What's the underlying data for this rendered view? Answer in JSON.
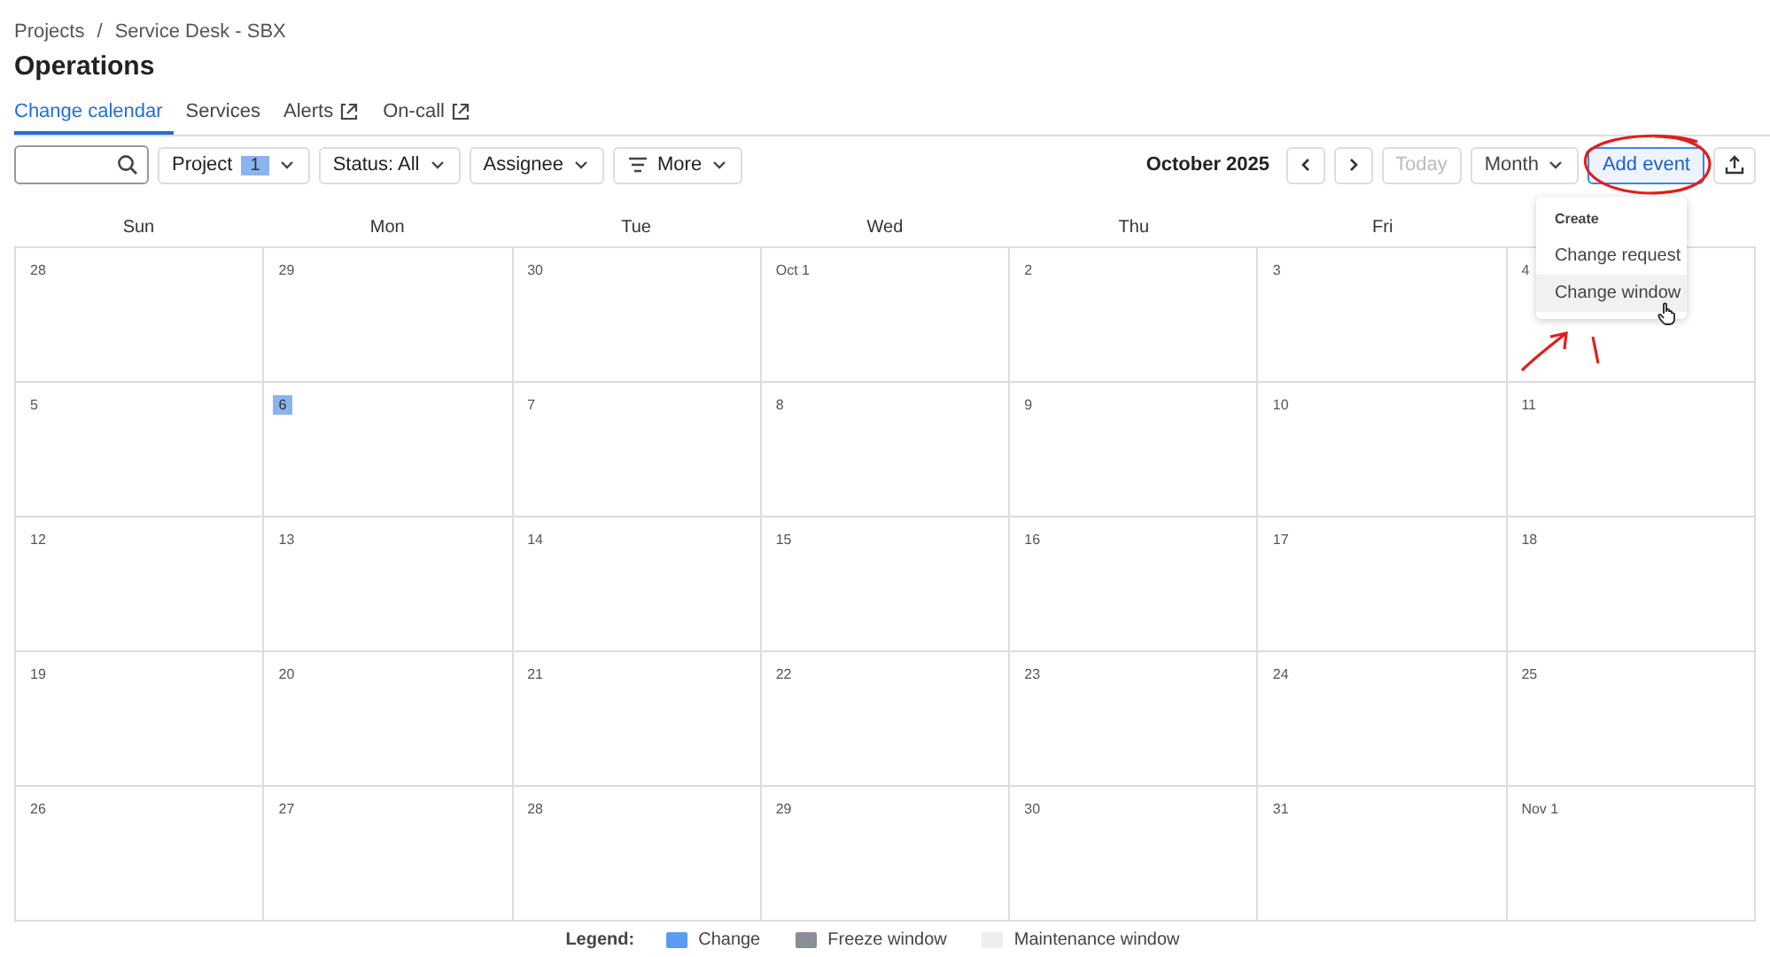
{
  "breadcrumb": [
    "Projects",
    "Service Desk - SBX"
  ],
  "breadcrumb_separator": "/",
  "title": "Operations",
  "tabs": [
    {
      "label": "Change calendar",
      "selected": true,
      "external": false
    },
    {
      "label": "Services",
      "selected": false,
      "external": false
    },
    {
      "label": "Alerts",
      "selected": false,
      "external": true
    },
    {
      "label": "On-call",
      "selected": false,
      "external": true
    }
  ],
  "filters": [
    {
      "label": "Project",
      "count": "1",
      "kind": "count"
    },
    {
      "label": "Status: All",
      "kind": "plain"
    },
    {
      "label": "Assignee",
      "kind": "plain"
    },
    {
      "label": "More",
      "kind": "more"
    }
  ],
  "period": "October 2025",
  "today_button": {
    "label": "Today",
    "disabled": true
  },
  "view": "Month",
  "add_button": "Add event",
  "menu": {
    "heading": "Create",
    "items": [
      {
        "label": "Change request",
        "hovered": false
      },
      {
        "label": "Change window",
        "hovered": true
      }
    ]
  },
  "weekdays": [
    "Sun",
    "Mon",
    "Tue",
    "Wed",
    "Thu",
    "Fri"
  ],
  "weeks": [
    [
      {
        "label": "28",
        "today": false
      },
      {
        "label": "29",
        "today": false
      },
      {
        "label": "30",
        "today": false
      },
      {
        "label": "Oct 1",
        "today": false
      },
      {
        "label": "2",
        "today": false
      },
      {
        "label": "3",
        "today": false
      },
      {
        "label": "4",
        "today": false
      }
    ],
    [
      {
        "label": "5",
        "today": false
      },
      {
        "label": "6",
        "today": true
      },
      {
        "label": "7",
        "today": false
      },
      {
        "label": "8",
        "today": false
      },
      {
        "label": "9",
        "today": false
      },
      {
        "label": "10",
        "today": false
      },
      {
        "label": "11",
        "today": false
      }
    ],
    [
      {
        "label": "12",
        "today": false
      },
      {
        "label": "13",
        "today": false
      },
      {
        "label": "14",
        "today": false
      },
      {
        "label": "15",
        "today": false
      },
      {
        "label": "16",
        "today": false
      },
      {
        "label": "17",
        "today": false
      },
      {
        "label": "18",
        "today": false
      }
    ],
    [
      {
        "label": "19",
        "today": false
      },
      {
        "label": "20",
        "today": false
      },
      {
        "label": "21",
        "today": false
      },
      {
        "label": "22",
        "today": false
      },
      {
        "label": "23",
        "today": false
      },
      {
        "label": "24",
        "today": false
      },
      {
        "label": "25",
        "today": false
      }
    ],
    [
      {
        "label": "26",
        "today": false
      },
      {
        "label": "27",
        "today": false
      },
      {
        "label": "28",
        "today": false
      },
      {
        "label": "29",
        "today": false
      },
      {
        "label": "30",
        "today": false
      },
      {
        "label": "31",
        "today": false
      },
      {
        "label": "Nov 1",
        "today": false
      }
    ]
  ],
  "legend": {
    "label": "Legend:",
    "items": [
      {
        "label": "Change",
        "color": "#5b9cf0"
      },
      {
        "label": "Freeze window",
        "color": "#8a8d93"
      },
      {
        "label": "Maintenance window",
        "color": "#eceef1"
      }
    ]
  }
}
